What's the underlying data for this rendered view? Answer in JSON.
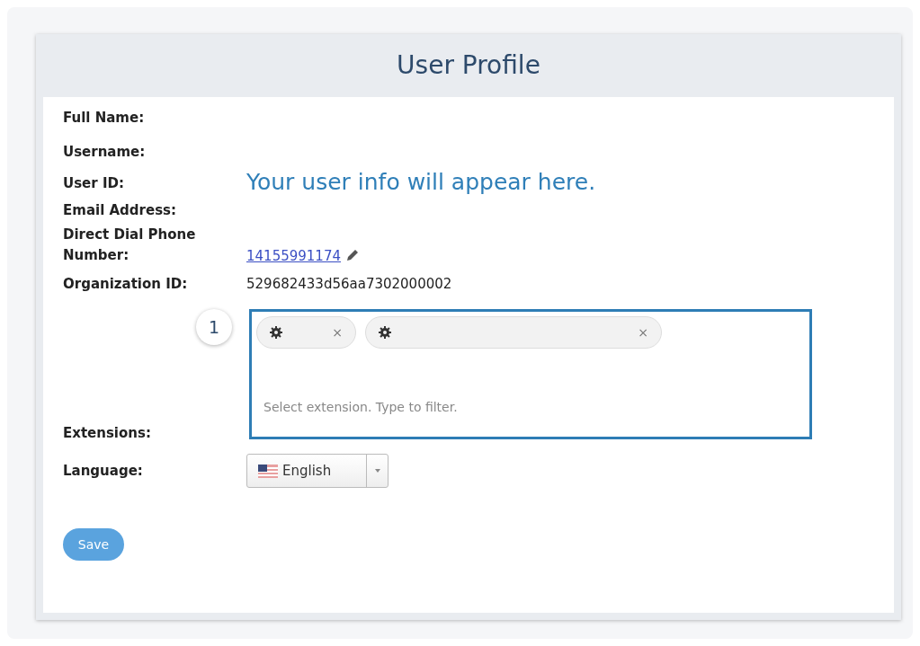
{
  "title": "User Profile",
  "fields": [
    {
      "label": "Full Name:"
    },
    {
      "label": "Username:"
    },
    {
      "label": "User ID:"
    },
    {
      "label": "Email Address:"
    },
    {
      "label": "Direct Dial Phone Number:",
      "kind": "link",
      "value": "14155991174"
    },
    {
      "label": "Organization ID:",
      "kind": "text",
      "value": "529682433d56aa7302000002"
    }
  ],
  "overlay_note": "Your user info will appear here.",
  "extensions": {
    "label": "Extensions:",
    "badge": "1",
    "chips": [
      {
        "remove": "×"
      },
      {
        "remove": "×"
      }
    ],
    "placeholder": "Select extension. Type to filter."
  },
  "language": {
    "label": "Language:",
    "value": "English"
  },
  "save_button": "Save"
}
